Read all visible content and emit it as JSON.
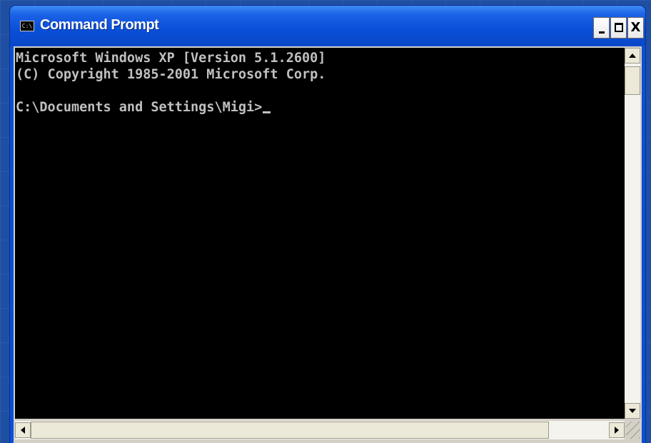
{
  "window": {
    "title": "Command Prompt",
    "icon_glyph": "C:\\",
    "icon": "cmd-icon",
    "buttons": {
      "minimize_icon": "minimize-icon",
      "maximize_icon": "maximize-icon",
      "close_label": "X"
    }
  },
  "console": {
    "lines": [
      "Microsoft Windows XP [Version 5.1.2600]",
      "(C) Copyright 1985-2001 Microsoft Corp.",
      "",
      "C:\\Documents and Settings\\Migi>"
    ],
    "text_color": "#c0c0c0",
    "background": "#000000"
  },
  "colors": {
    "titlebar": "#0a4fd8",
    "desktop": "#1f4fa3",
    "frame": "#d4d0c8"
  }
}
